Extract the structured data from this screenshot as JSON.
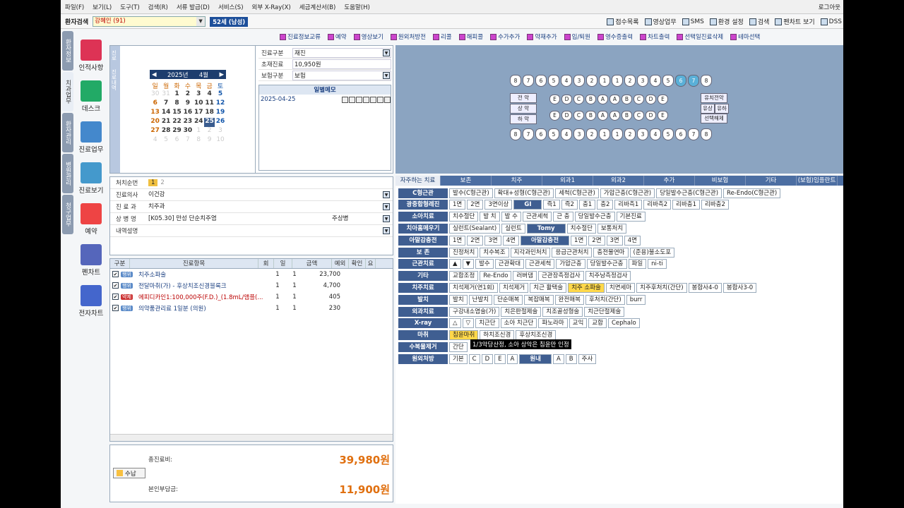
{
  "menu": [
    "파일(F)",
    "보기(L)",
    "도구(T)",
    "검색(R)",
    "서류 발급(D)",
    "서비스(S)",
    "외부 X-Ray(X)",
    "세금계산서(B)",
    "도움말(H)"
  ],
  "login": "로그아웃",
  "patient": {
    "label": "환자검색",
    "name": "강혜인 (91)",
    "age": "52세 (남성)"
  },
  "topright": [
    "접수목록",
    "영상업무",
    "SMS",
    "환경 설정",
    "검색",
    "펜차트 보기",
    "DSS"
  ],
  "toolbar": [
    "진료정보교류",
    "예약",
    "영상보기",
    "원외처방전",
    "리콜",
    "해피콜",
    "수가추가",
    "약재추가",
    "입/퇴원",
    "영수증출력",
    "차트출력",
    "선택일진료삭제",
    "테마선택"
  ],
  "vtabs": [
    "환자정보",
    "치과업무",
    "환자관리",
    "병원관리",
    "청구업무"
  ],
  "nav": [
    "인적사항",
    "데스크",
    "진료업무",
    "진료보기",
    "예약",
    "펜차트",
    "전자차트"
  ],
  "calendar": {
    "side": [
      "진료",
      "진료내역"
    ],
    "year": "2025년",
    "month": "4월",
    "days": [
      "일",
      "월",
      "화",
      "수",
      "목",
      "금",
      "토"
    ],
    "rows": [
      [
        "30",
        "31",
        "1",
        "2",
        "3",
        "4",
        "5"
      ],
      [
        "6",
        "7",
        "8",
        "9",
        "10",
        "11",
        "12"
      ],
      [
        "13",
        "14",
        "15",
        "16",
        "17",
        "18",
        "19"
      ],
      [
        "20",
        "21",
        "22",
        "23",
        "24",
        "25",
        "26"
      ],
      [
        "27",
        "28",
        "29",
        "30",
        "1",
        "2",
        "3"
      ],
      [
        "4",
        "5",
        "6",
        "7",
        "8",
        "9",
        "10"
      ]
    ]
  },
  "visit": [
    {
      "label": "진료구분",
      "value": "재진",
      "dd": true
    },
    {
      "label": "초재진료",
      "value": "10,950원",
      "dd": false
    },
    {
      "label": "보험구분",
      "value": "보험",
      "dd": true
    }
  ],
  "memo": {
    "title": "일별메모",
    "date": "2025-04-25"
  },
  "treatment": {
    "seq_label": "처치순번",
    "seq": [
      "1",
      "2"
    ],
    "doctor_label": "진료의사",
    "doctor": "이건강",
    "dept_label": "진 료 과",
    "dept": "치주과",
    "dx_label": "상 병 명",
    "dx": "[K05.30] 만성 단순치주염",
    "dx_type": "주상병",
    "desc_label": "내역설명"
  },
  "table": {
    "headers": [
      "구분",
      "진료항목",
      "회",
      "일",
      "금액",
      "예외",
      "확인",
      "요"
    ],
    "rows": [
      {
        "type": "행위",
        "item": "치주소파술",
        "times": "1",
        "days": "1",
        "amount": "23,700"
      },
      {
        "type": "행위",
        "item": "전달마취(가) - 후상치조신경블록크",
        "times": "1",
        "days": "1",
        "amount": "4,700"
      },
      {
        "type": "약제",
        "item": "에피디카인1:100,000주(F.D.)_(1.8mL/앰플(...",
        "times": "1",
        "days": "1",
        "amount": "405"
      },
      {
        "type": "행위",
        "item": "의약품관리료 1일분 (의원)",
        "times": "1",
        "days": "1",
        "amount": "230"
      }
    ]
  },
  "totals": {
    "total_label": "총진료비:",
    "total": "39,980원",
    "pay_label": "수납",
    "self_label": "본인부담금:",
    "self": "11,900원"
  },
  "teeth": {
    "upper": [
      "8",
      "7",
      "6",
      "5",
      "4",
      "3",
      "2",
      "1",
      "1",
      "2",
      "3",
      "4",
      "5",
      "6",
      "7",
      "8"
    ],
    "upper_selected": [
      13,
      14
    ],
    "prim_upper": [
      "E",
      "D",
      "C",
      "B",
      "A",
      "A",
      "B",
      "C",
      "D",
      "E"
    ],
    "prim_lower": [
      "E",
      "D",
      "C",
      "B",
      "A",
      "A",
      "B",
      "C",
      "D",
      "E"
    ],
    "lower": [
      "8",
      "7",
      "6",
      "5",
      "4",
      "3",
      "2",
      "1",
      "1",
      "2",
      "3",
      "4",
      "5",
      "6",
      "7",
      "8"
    ],
    "left_labels": [
      "전 악",
      "상 악",
      "하 악"
    ],
    "right_labels": [
      "유치전악",
      "유상",
      "유하",
      "선택해제"
    ]
  },
  "tabs": [
    "자주하는 치료",
    "보존",
    "치주",
    "외과1",
    "외과2",
    "추가",
    "비보험",
    "기타",
    "(보험)임플란트"
  ],
  "buttons": [
    {
      "cat": "C형근관",
      "items": [
        "발수(C형근관)",
        "확대+성형(C형근관)",
        "세척(C형근관)",
        "가압근충(C형근관)",
        "당일발수근충(C형근관)",
        "Re-Endo(C형근관)"
      ]
    },
    {
      "cat": "광중합형레진",
      "items": [
        "1면",
        "2면",
        "3면이상"
      ],
      "cat2": "GI",
      "items2": [
        "즉1",
        "즉2",
        "충1",
        "충2",
        "리바측1",
        "리바측2",
        "리바충1",
        "리바충2"
      ]
    },
    {
      "cat": "소아치료",
      "items": [
        "치수절단",
        "발 치",
        "발 수",
        "근관세척",
        "근 충",
        "당일발수근충",
        "기본진료"
      ]
    },
    {
      "cat": "치아홈메우기",
      "items": [
        "실런트(Sealant)",
        "실런트"
      ],
      "cat2": "Tomy",
      "items2": [
        "치수절단",
        "보통처치"
      ]
    },
    {
      "cat": "아말감충전",
      "items": [
        "1면",
        "2면",
        "3면",
        "4면"
      ],
      "cat2": "아말감충전",
      "items2": [
        "1면",
        "2면",
        "3면",
        "4면"
      ]
    },
    {
      "cat": "보 존",
      "items": [
        "진정처치",
        "치수복조",
        "지각과민처치",
        "응급근관처치",
        "충전물연마",
        "(준용)불소도포"
      ]
    },
    {
      "cat": "근관치료",
      "items": [
        "▲",
        "▼",
        "발수",
        "근관확대",
        "근관세척",
        "가압근충",
        "당일발수근충",
        "파일",
        "ni-ti"
      ]
    },
    {
      "cat": "기타",
      "items": [
        "교합조정",
        "Re-Endo",
        "러버댐",
        "근관장측정검사",
        "치주낭측정검사"
      ]
    },
    {
      "cat": "치주치료",
      "items": [
        "치석제거(연1회)",
        "치석제거",
        "치근 활택술",
        "치주 소파술",
        "치면세마",
        "치주후처치(간단)",
        "봉합사4-0",
        "봉합사3-0"
      ]
    },
    {
      "cat": "발치",
      "items": [
        "발치",
        "난발치",
        "단순매복",
        "복잡매복",
        "완전매복",
        "후처치(간단)",
        "burr"
      ]
    },
    {
      "cat": "외과치료",
      "items": [
        "구강내소염술(가)",
        "치은판절제술",
        "치조골성형술",
        "치근단절제술"
      ]
    },
    {
      "cat": "X-ray",
      "items": [
        "△",
        "▽",
        "치근단",
        "소아 치근단",
        "파노라마",
        "교익",
        "교합",
        "Cephalo"
      ]
    },
    {
      "cat": "마취",
      "items": [
        "침윤마취",
        "하치조신경",
        "후상치조신경"
      ]
    },
    {
      "cat": "수복물제거",
      "items": [
        "간단"
      ]
    },
    {
      "cat": "원외처방",
      "items": [
        "기본",
        "C",
        "D",
        "E",
        "A"
      ],
      "cat2": "원내",
      "items2": [
        "A",
        "B",
        "주사"
      ]
    }
  ],
  "tooltip": "1/3악당산정, 소아 상악은 침윤만 인정"
}
